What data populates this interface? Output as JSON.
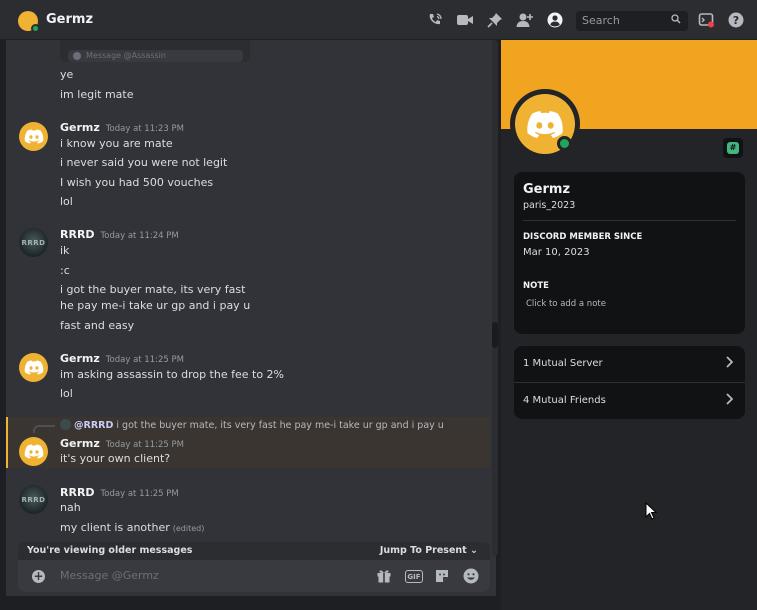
{
  "header": {
    "title": "Germz",
    "search_placeholder": "Search"
  },
  "chat": {
    "embed_placeholder": "Message @Assassin",
    "groups": [
      {
        "lines": [
          "ye",
          "im legit mate"
        ]
      },
      {
        "author": "Germz",
        "timestamp": "Today at 11:23 PM",
        "lines": [
          "i know you are mate",
          "i never said you were not legit",
          "I wish you had 500 vouches",
          "lol"
        ]
      },
      {
        "author": "RRRD",
        "timestamp": "Today at 11:24 PM",
        "lines": [
          "ik",
          ":c",
          "i got the buyer mate, its very fast",
          "he pay me-i take ur gp and i pay u",
          "fast and easy"
        ]
      },
      {
        "author": "Germz",
        "timestamp": "Today at 11:25 PM",
        "lines": [
          "im asking assassin to drop the fee to 2%",
          "lol"
        ]
      },
      {
        "author": "Germz",
        "timestamp": "Today at 11:25 PM",
        "reply_mention": "@RRRD",
        "reply_text": "i got the buyer mate, its very fast he pay me-i take ur gp and i pay u",
        "lines": [
          "it's your own client?"
        ]
      },
      {
        "author": "RRRD",
        "timestamp": "Today at 11:25 PM",
        "lines": [
          "nah",
          "my client is another"
        ],
        "edited": "(edited)"
      }
    ],
    "rrrd_avatar_text": "RRRD",
    "older_banner": "You're viewing older messages",
    "jump_label": "Jump To Present",
    "composer_placeholder": "Message @Germz",
    "gif_label": "GIF"
  },
  "profile": {
    "display_name": "Germz",
    "username": "paris_2023",
    "member_since_label": "DISCORD MEMBER SINCE",
    "member_since": "Mar 10, 2023",
    "note_label": "NOTE",
    "note_placeholder": "Click to add a note",
    "mutual_servers": "1 Mutual Server",
    "mutual_friends": "4 Mutual Friends",
    "badge_glyph": "#"
  },
  "colors": {
    "brand_yellow": "#f0b232",
    "banner": "#f0a41f",
    "online": "#23a55a"
  }
}
